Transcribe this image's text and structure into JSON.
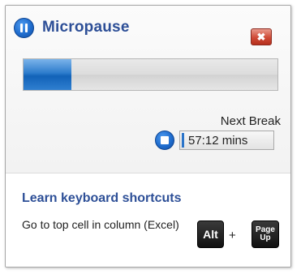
{
  "window": {
    "title": "Micropause",
    "close_symbol": "✖",
    "icon": "pause-icon"
  },
  "progress": {
    "fraction": 0.19
  },
  "next_break": {
    "label": "Next Break",
    "time": "57:12 mins",
    "icon": "stop-icon"
  },
  "tips": {
    "link_label": "Learn keyboard shortcuts",
    "description": "Go to top cell in column (Excel)",
    "keys": [
      "Alt",
      "Page\nUp"
    ],
    "separator": "+"
  },
  "colors": {
    "accent_blue": "#2d4f97",
    "progress_blue": "#1262b8",
    "close_red": "#cf4a36",
    "key_black": "#111111"
  }
}
